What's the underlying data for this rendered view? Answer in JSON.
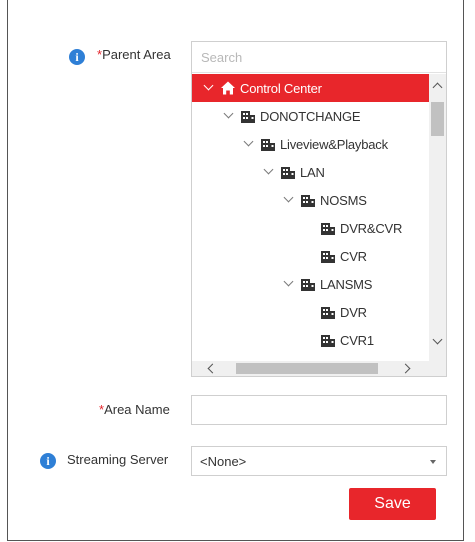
{
  "form": {
    "parent_area": {
      "required_mark": "*",
      "label": "Parent Area"
    },
    "area_name": {
      "required_mark": "*",
      "label": "Area Name",
      "value": ""
    },
    "streaming_server": {
      "label": "Streaming Server",
      "selected": "<None>"
    },
    "save_label": "Save"
  },
  "tree": {
    "search_placeholder": "Search",
    "nodes": [
      {
        "label": "Control Center",
        "icon": "home-icon",
        "expanded": true,
        "selected": true
      },
      {
        "label": "DONOTCHANGE",
        "icon": "building-icon",
        "expanded": true
      },
      {
        "label": "Liveview&Playback",
        "icon": "building-icon",
        "expanded": true
      },
      {
        "label": "LAN",
        "icon": "building-icon",
        "expanded": true
      },
      {
        "label": "NOSMS",
        "icon": "building-icon",
        "expanded": true
      },
      {
        "label": "DVR&CVR",
        "icon": "building-icon",
        "expanded": false
      },
      {
        "label": "CVR",
        "icon": "building-icon",
        "expanded": false
      },
      {
        "label": "LANSMS",
        "icon": "building-icon",
        "expanded": true
      },
      {
        "label": "DVR",
        "icon": "building-icon",
        "expanded": false
      },
      {
        "label": "CVR1",
        "icon": "building-icon",
        "expanded": false
      }
    ]
  },
  "colors": {
    "accent": "#e8262b",
    "info": "#2e7fd6",
    "border": "#cfcfcf"
  }
}
